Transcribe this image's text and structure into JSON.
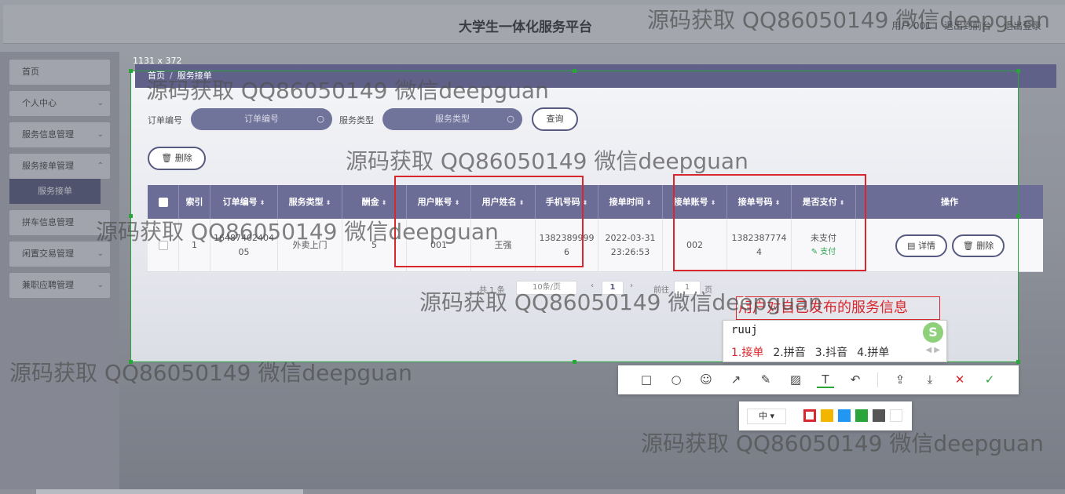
{
  "header": {
    "title": "大学生一体化服务平台",
    "user_label": "用户 001",
    "back_link": "退出到前台",
    "logout_link": "退出登录"
  },
  "sidebar": {
    "items": [
      {
        "label": "首页"
      },
      {
        "label": "个人中心"
      },
      {
        "label": "服务信息管理"
      },
      {
        "label": "服务接单管理"
      },
      {
        "label": "拼车信息管理"
      },
      {
        "label": "闲置交易管理"
      },
      {
        "label": "兼职应聘管理"
      }
    ],
    "active_sub": "服务接单"
  },
  "breadcrumb": {
    "home": "首页",
    "separator": "/",
    "current": "服务接单"
  },
  "search": {
    "order_label": "订单编号",
    "order_placeholder": "订单编号",
    "type_label": "服务类型",
    "type_placeholder": "服务类型",
    "query_button": "查询",
    "delete_button": "删除"
  },
  "table": {
    "headers": [
      "索引",
      "订单编号",
      "服务类型",
      "酬金",
      "用户账号",
      "用户姓名",
      "手机号码",
      "接单时间",
      "接单账号",
      "接单号码",
      "是否支付",
      "操作"
    ],
    "rows": [
      {
        "index": "1",
        "order_no": "1648740240405",
        "service_type": "外卖上门",
        "reward": "5",
        "user_account": "001",
        "user_name": "王强",
        "phone": "13823899996",
        "time": "2022-03-31 23:26:53",
        "taker_account": "002",
        "taker_phone": "13823877744",
        "paid": "未支付",
        "pay_link": "支付",
        "detail_btn": "详情",
        "delete_btn": "删除"
      }
    ]
  },
  "pagination": {
    "total": "共 1 条",
    "page_size": "10条/页",
    "current": "1",
    "goto_prefix": "前往",
    "goto_value": "1",
    "goto_suffix": "页"
  },
  "screenshot_tool": {
    "size_label": "1131 x 372",
    "annotation_text": "用户对自己发布的服务信息",
    "font_size": "中",
    "colors": [
      "#d8282e",
      "#f2b600",
      "#2196f3",
      "#2aa53a",
      "#555555",
      "#ffffff"
    ]
  },
  "ime": {
    "input": "ruuj",
    "candidates": [
      "1.接单",
      "2.拼音",
      "3.抖音",
      "4.拼单"
    ],
    "logo": "S"
  },
  "watermark": "源码获取 QQ86050149 微信deepguan"
}
